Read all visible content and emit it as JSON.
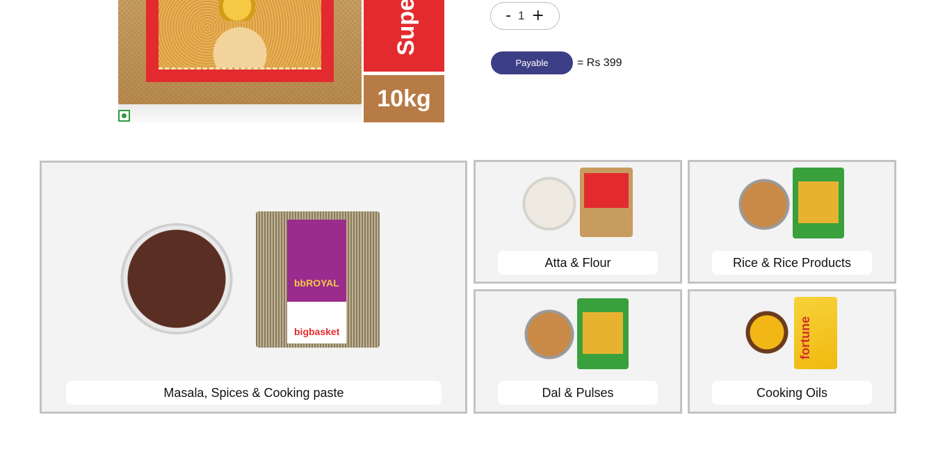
{
  "product": {
    "image_side_text": "Supe",
    "image_weight_text": "10kg"
  },
  "quantity": {
    "minus": "-",
    "value": "1",
    "plus": "+"
  },
  "payable": {
    "button_label": "Payable",
    "total_text": "= Rs 399",
    "button_color": "#3c3e86"
  },
  "categories": [
    {
      "label": "Masala, Spices & Cooking paste"
    },
    {
      "label": "Atta & Flour"
    },
    {
      "label": "Rice & Rice Products"
    },
    {
      "label": "Dal & Pulses"
    },
    {
      "label": "Cooking Oils"
    }
  ],
  "colors": {
    "tile_bg": "#f3f3f3",
    "tile_border": "#c4c3c4",
    "packet_red": "#e32b2f",
    "packet_green": "#3aa03c"
  }
}
